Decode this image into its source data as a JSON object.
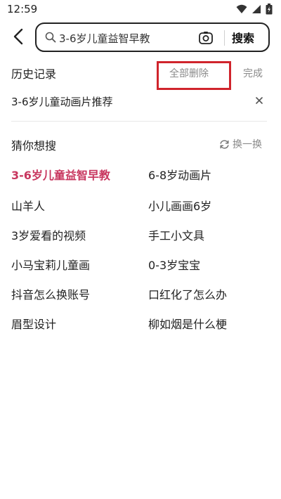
{
  "status_bar": {
    "time": "12:59",
    "icons": [
      "wifi-icon",
      "signal-icon",
      "battery-icon"
    ]
  },
  "search": {
    "value": "3-6岁儿童益智早教",
    "button_label": "搜索",
    "icons": [
      "back-icon",
      "search-icon",
      "scan-icon"
    ]
  },
  "history": {
    "title": "历史记录",
    "delete_all_label": "全部删除",
    "done_label": "完成",
    "items": [
      {
        "text": "3-6岁儿童动画片推荐"
      }
    ]
  },
  "guess": {
    "title": "猜你想搜",
    "refresh_label": "换一换",
    "highlight_color": "#c8375f",
    "items": [
      {
        "text": "3-6岁儿童益智早教",
        "highlighted": true
      },
      {
        "text": "6-8岁动画片",
        "highlighted": false
      },
      {
        "text": "山羊人",
        "highlighted": false
      },
      {
        "text": "小儿画画6岁",
        "highlighted": false
      },
      {
        "text": "3岁爱看的视频",
        "highlighted": false
      },
      {
        "text": "手工小文具",
        "highlighted": false
      },
      {
        "text": "小马宝莉儿童画",
        "highlighted": false
      },
      {
        "text": "0-3岁宝宝",
        "highlighted": false
      },
      {
        "text": "抖音怎么换账号",
        "highlighted": false
      },
      {
        "text": "口红化了怎么办",
        "highlighted": false
      },
      {
        "text": "眉型设计",
        "highlighted": false
      },
      {
        "text": "柳如烟是什么梗",
        "highlighted": false
      }
    ]
  },
  "accent_colors": {
    "annotation_box": "#d0242c"
  }
}
